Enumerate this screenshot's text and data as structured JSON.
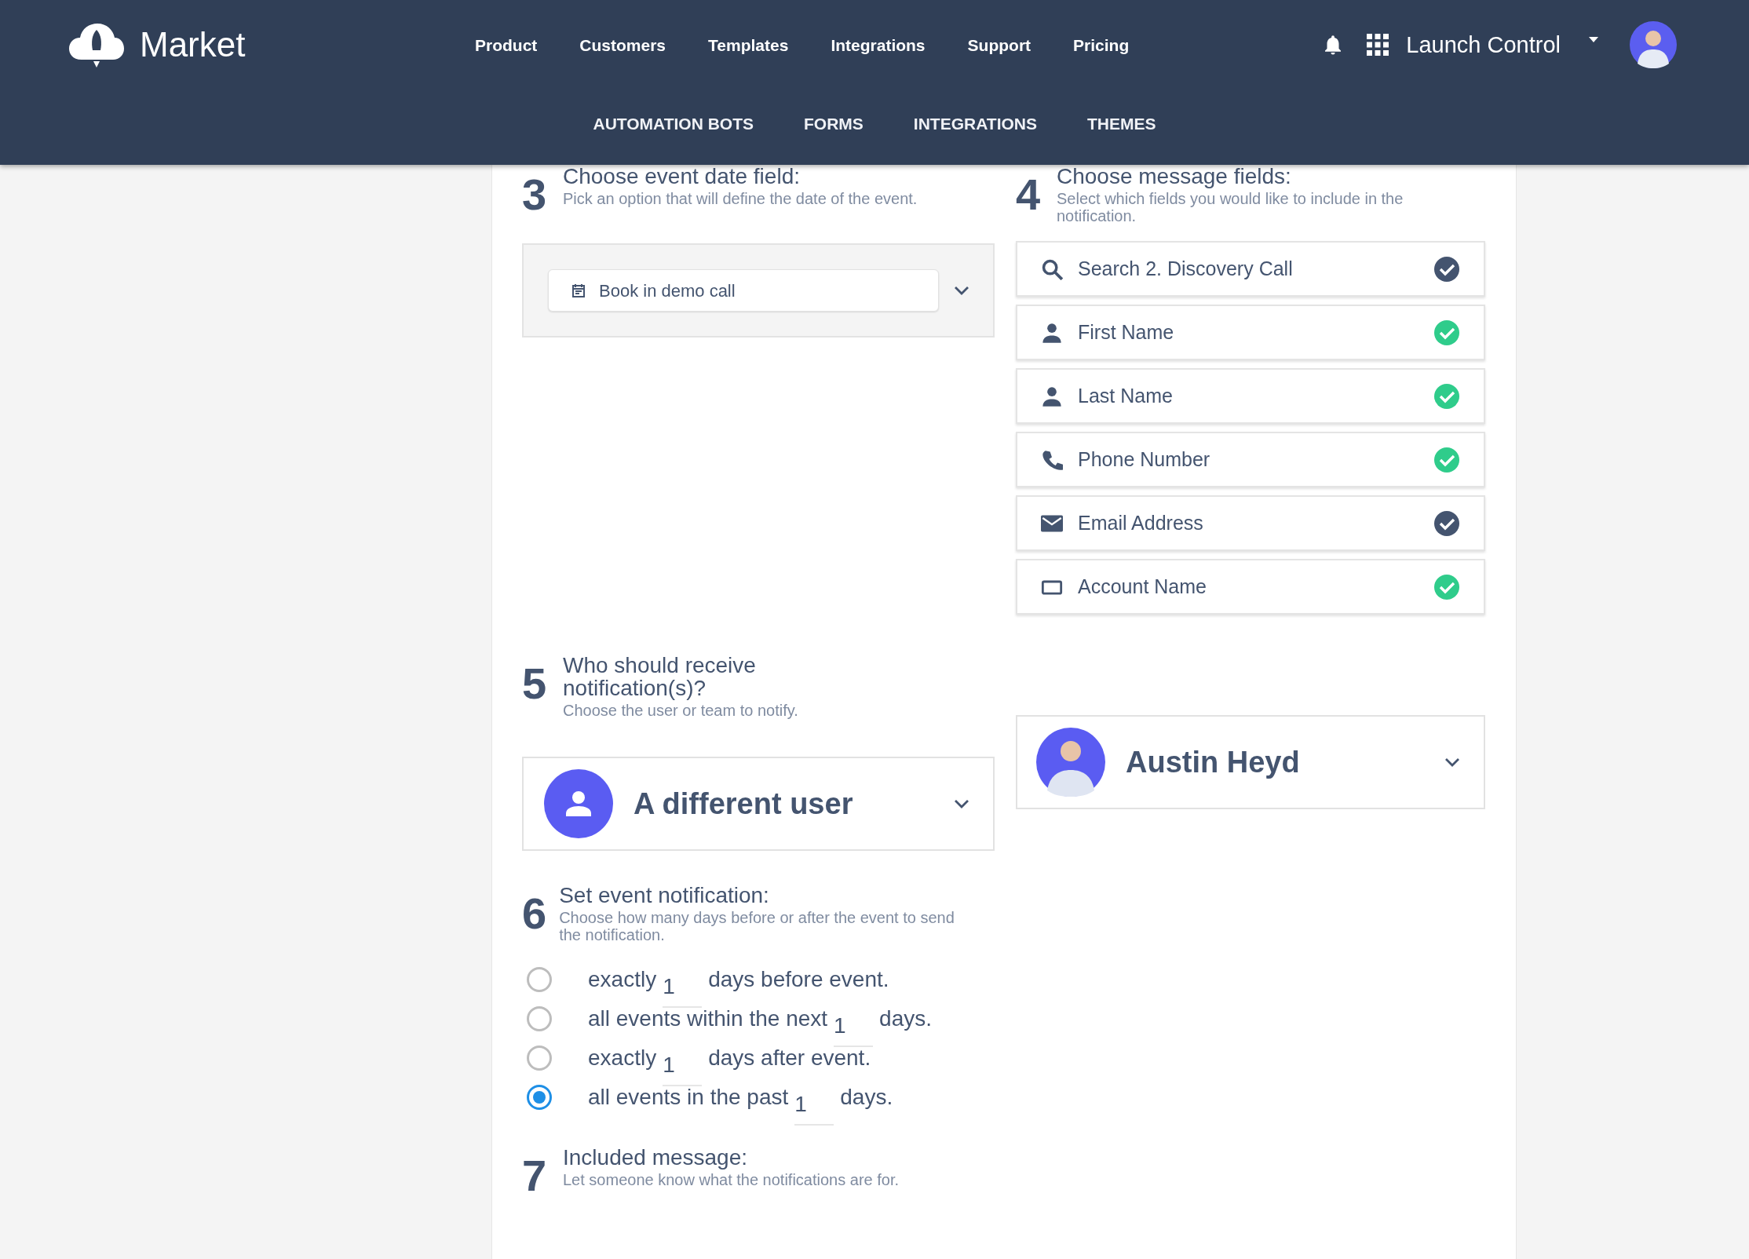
{
  "header": {
    "logo_text": "Market",
    "nav": [
      "Product",
      "Customers",
      "Templates",
      "Integrations",
      "Support",
      "Pricing"
    ],
    "account_name": "Launch Control",
    "subnav": [
      "AUTOMATION BOTS",
      "FORMS",
      "INTEGRATIONS",
      "THEMES"
    ]
  },
  "step3": {
    "number": "3",
    "title": "Choose event date field:",
    "subtitle": "Pick an option that will define the date of the event.",
    "date_field": "Book in demo call"
  },
  "step4": {
    "number": "4",
    "title": "Choose message fields:",
    "subtitle": "Select which fields you would like to include in the notification.",
    "fields": [
      {
        "kind": "search",
        "label": "Search 2. Discovery Call",
        "color": "#44546f"
      },
      {
        "kind": "person",
        "label": "First Name",
        "color": "#2fcc8b"
      },
      {
        "kind": "person",
        "label": "Last Name",
        "color": "#2fcc8b"
      },
      {
        "kind": "phone",
        "label": "Phone Number",
        "color": "#2fcc8b"
      },
      {
        "kind": "email",
        "label": "Email Address",
        "color": "#44546f"
      },
      {
        "kind": "account",
        "label": "Account Name",
        "color": "#2fcc8b"
      }
    ]
  },
  "step5": {
    "number": "5",
    "title": "Who should receive notification(s)?",
    "subtitle": "Choose the user or team to notify.",
    "recipient_type": "A different user",
    "user": "Austin Heyd"
  },
  "step6": {
    "number": "6",
    "title": "Set event notification:",
    "subtitle": "Choose how many days before or after the event to send the notification.",
    "options": [
      {
        "prefix": "exactly",
        "value": "1",
        "suffix": "days before event.",
        "selected": false
      },
      {
        "prefix": "all events within the next",
        "value": "1",
        "suffix": "days.",
        "selected": false
      },
      {
        "prefix": "exactly",
        "value": "1",
        "suffix": "days after event.",
        "selected": false
      },
      {
        "prefix": "all events in the past",
        "value": "1",
        "suffix": "days.",
        "selected": true
      }
    ]
  },
  "step7": {
    "number": "7",
    "title": "Included message:",
    "subtitle": "Let someone know what the notifications are for."
  }
}
